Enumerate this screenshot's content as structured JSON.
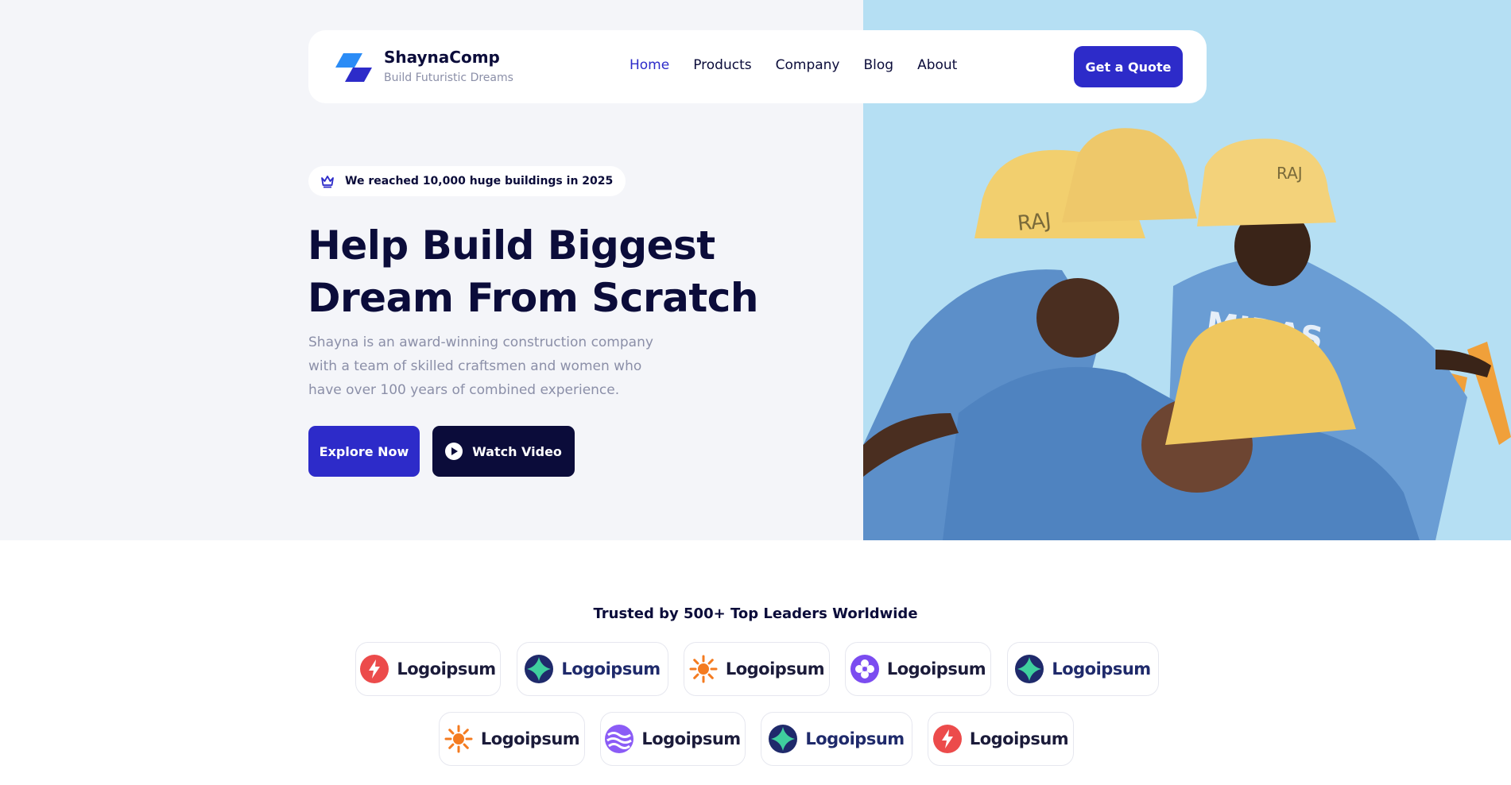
{
  "nav": {
    "brand_name": "ShaynaComp",
    "brand_tagline": "Build Futuristic Dreams",
    "links": [
      {
        "label": "Home",
        "active": true
      },
      {
        "label": "Products"
      },
      {
        "label": "Company"
      },
      {
        "label": "Blog"
      },
      {
        "label": "About"
      }
    ],
    "cta_label": "Get a Quote"
  },
  "hero": {
    "badge_text": "We reached 10,000 huge buildings in 2025",
    "headline_line1": "Help Build Biggest",
    "headline_line2": "Dream From Scratch",
    "lead": "Shayna is an award-winning construction company with a team of skilled craftsmen and women who have over 100 years of combined experience.",
    "explore_label": "Explore Now",
    "watch_label": "Watch Video"
  },
  "partners": {
    "heading": "Trusted by 500+ Top Leaders Worldwide",
    "logos": [
      {
        "name": "Logoipsum",
        "icon": "bolt-red"
      },
      {
        "name": "Logoipsum",
        "icon": "diamond-teal"
      },
      {
        "name": "Logoipsum",
        "icon": "sun-orange"
      },
      {
        "name": "Logoipsum",
        "icon": "flower-purple"
      },
      {
        "name": "Logoipsum",
        "icon": "diamond-teal"
      },
      {
        "name": "Logoipsum",
        "icon": "sun-orange"
      },
      {
        "name": "Logoipsum",
        "icon": "waves-purple"
      },
      {
        "name": "Logoipsum",
        "icon": "diamond-teal"
      },
      {
        "name": "Logoipsum",
        "icon": "bolt-red"
      }
    ]
  },
  "colors": {
    "primary": "#2d2bc9",
    "dark": "#0b0c3a",
    "muted": "#8b8fa8",
    "hero_bg": "#f4f5f9",
    "sky": "#b8e0f2"
  }
}
